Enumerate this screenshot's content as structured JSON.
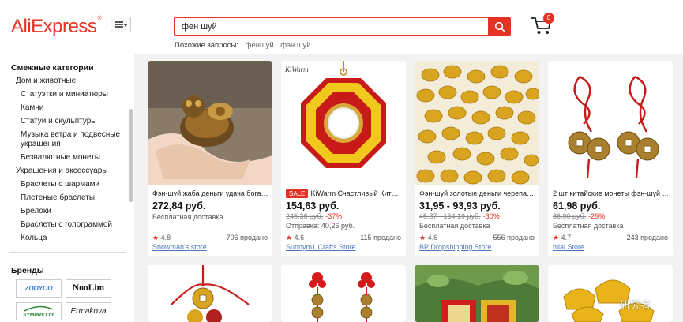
{
  "header": {
    "logo": "AliExpress",
    "search_value": "фен шуй",
    "related_label": "Похожие запросы:",
    "related": [
      "феншуй",
      "фэн шуй"
    ],
    "cart_count": "0",
    "accent_color": "#e43225"
  },
  "sidebar": {
    "categories_title": "Смежные категории",
    "items": [
      "Дом и животные",
      "Статуэтки и миниатюры",
      "Камни",
      "Статуи и скульптуры",
      "Музыка ветра и подвесные",
      "украшения",
      "Безвалютные монеты",
      "Украшения и аксессуары",
      "Браслеты с шармами",
      "Плетеные браслеты",
      "Брелоки",
      "Браслеты с голограммой",
      "Кольца"
    ],
    "brands_title": "Бренды",
    "brands": [
      "ZOOYOO",
      "NooLim",
      "SYMPRETTY",
      "Ermakova"
    ]
  },
  "products": [
    {
      "title": "Фэн-шуй жаба деньги удача бога…",
      "price": "272,84 руб.",
      "shipping": "Бесплатная доставка",
      "rating": "4.8",
      "sold": "706 продано",
      "store": "Snowman's store"
    },
    {
      "sale_badge": "SALE",
      "title": "KiWarm Счастливый Кит…",
      "price": "154,63 руб.",
      "old_price": "245,36 руб.",
      "discount": "-37%",
      "shipping": "Отправка: 40,26 руб.",
      "rating": "4.6",
      "sold": "115 продано",
      "store": "Sunnym1 Crafts Store",
      "image_label": "KiWarm"
    },
    {
      "title": "Фэн-шуй золотые деньги черепа…",
      "price": "31,95 - 93,93 руб.",
      "old_price": "45,37 - 134,19 руб.",
      "discount": "-30%",
      "shipping": "Бесплатная доставка",
      "rating": "4.6",
      "sold": "556 продано",
      "store": "BP Dropshipping Store"
    },
    {
      "title": "2 шт китайские монеты фэн-шуй …",
      "price": "61,98 руб.",
      "old_price": "86,90 руб.",
      "discount": "-29%",
      "shipping": "Бесплатная доставка",
      "rating": "4.7",
      "sold": "243 продано",
      "store": "hllai Store"
    }
  ],
  "watermark": "研究者"
}
